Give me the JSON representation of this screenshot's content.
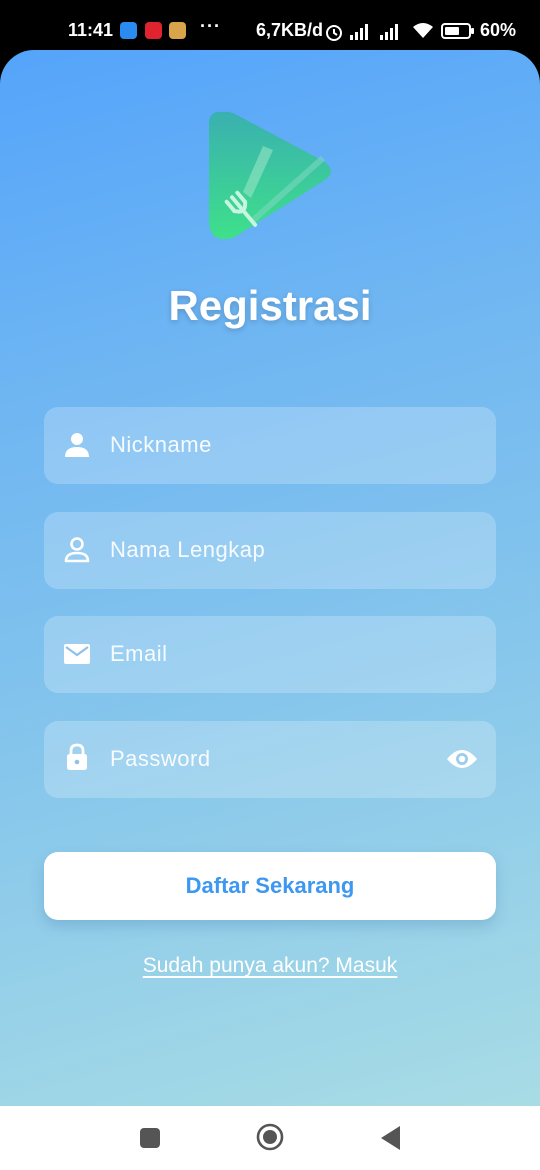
{
  "status_bar": {
    "time": "11:41",
    "dots": "···",
    "network_speed": "6,7KB/d",
    "battery_percent": "60%"
  },
  "screen": {
    "title": "Registrasi",
    "fields": {
      "nickname": {
        "placeholder": "Nickname",
        "icon": "person-icon"
      },
      "full_name": {
        "placeholder": "Nama Lengkap",
        "icon": "person-outline-icon"
      },
      "email": {
        "placeholder": "Email",
        "icon": "mail-icon"
      },
      "password": {
        "placeholder": "Password",
        "icon": "lock-icon",
        "toggle_icon": "eye-icon"
      }
    },
    "submit_label": "Daftar Sekarang",
    "login_link": "Sudah punya akun? Masuk"
  },
  "colors": {
    "gradient_top": "#54a4fb",
    "gradient_bottom": "#a8dce5",
    "button_text": "#3e97f0",
    "logo_green": "#3ed68a"
  }
}
